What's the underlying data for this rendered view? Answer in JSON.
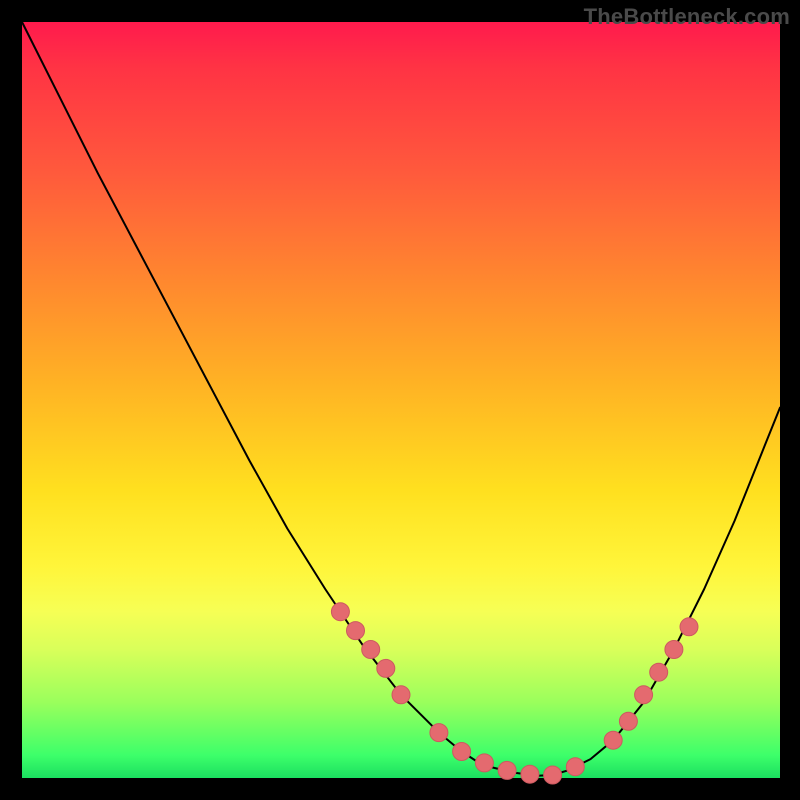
{
  "watermark": "TheBottleneck.com",
  "colors": {
    "curve": "#000000",
    "marker_fill": "#e46a6f",
    "marker_stroke": "#cc5a60",
    "gradient_stops": [
      "#ff1a4d",
      "#ff3344",
      "#ff5a3c",
      "#ff8a2e",
      "#ffb324",
      "#ffe01f",
      "#fff53a",
      "#f6ff55",
      "#d9ff5a",
      "#9aff5c",
      "#3dff6a",
      "#1bdf60"
    ]
  },
  "chart_data": {
    "type": "line",
    "title": "",
    "xlabel": "",
    "ylabel": "",
    "xlim": [
      0,
      100
    ],
    "ylim": [
      0,
      100
    ],
    "x": [
      0,
      5,
      10,
      15,
      20,
      25,
      30,
      35,
      40,
      45,
      50,
      55,
      58,
      60,
      62,
      65,
      68,
      70,
      72,
      75,
      78,
      82,
      86,
      90,
      94,
      98,
      100
    ],
    "y": [
      100,
      90,
      80,
      70.5,
      61,
      51.5,
      42,
      33,
      25,
      17.5,
      11,
      6,
      3.5,
      2.2,
      1.4,
      0.7,
      0.3,
      0.4,
      1,
      2.5,
      5,
      10,
      17,
      25,
      34,
      44,
      49
    ],
    "series": [
      {
        "name": "bottleneck-curve",
        "role": "line",
        "color": "#000000"
      },
      {
        "name": "highlight-points",
        "role": "markers",
        "color": "#e46a6f",
        "points_x": [
          42,
          44,
          46,
          48,
          50,
          55,
          58,
          61,
          64,
          67,
          70,
          73,
          78,
          80,
          82,
          84,
          86,
          88
        ],
        "points_y": [
          22,
          19.5,
          17,
          14.5,
          11,
          6,
          3.5,
          2,
          1,
          0.5,
          0.4,
          1.5,
          5,
          7.5,
          11,
          14,
          17,
          20
        ]
      }
    ]
  }
}
